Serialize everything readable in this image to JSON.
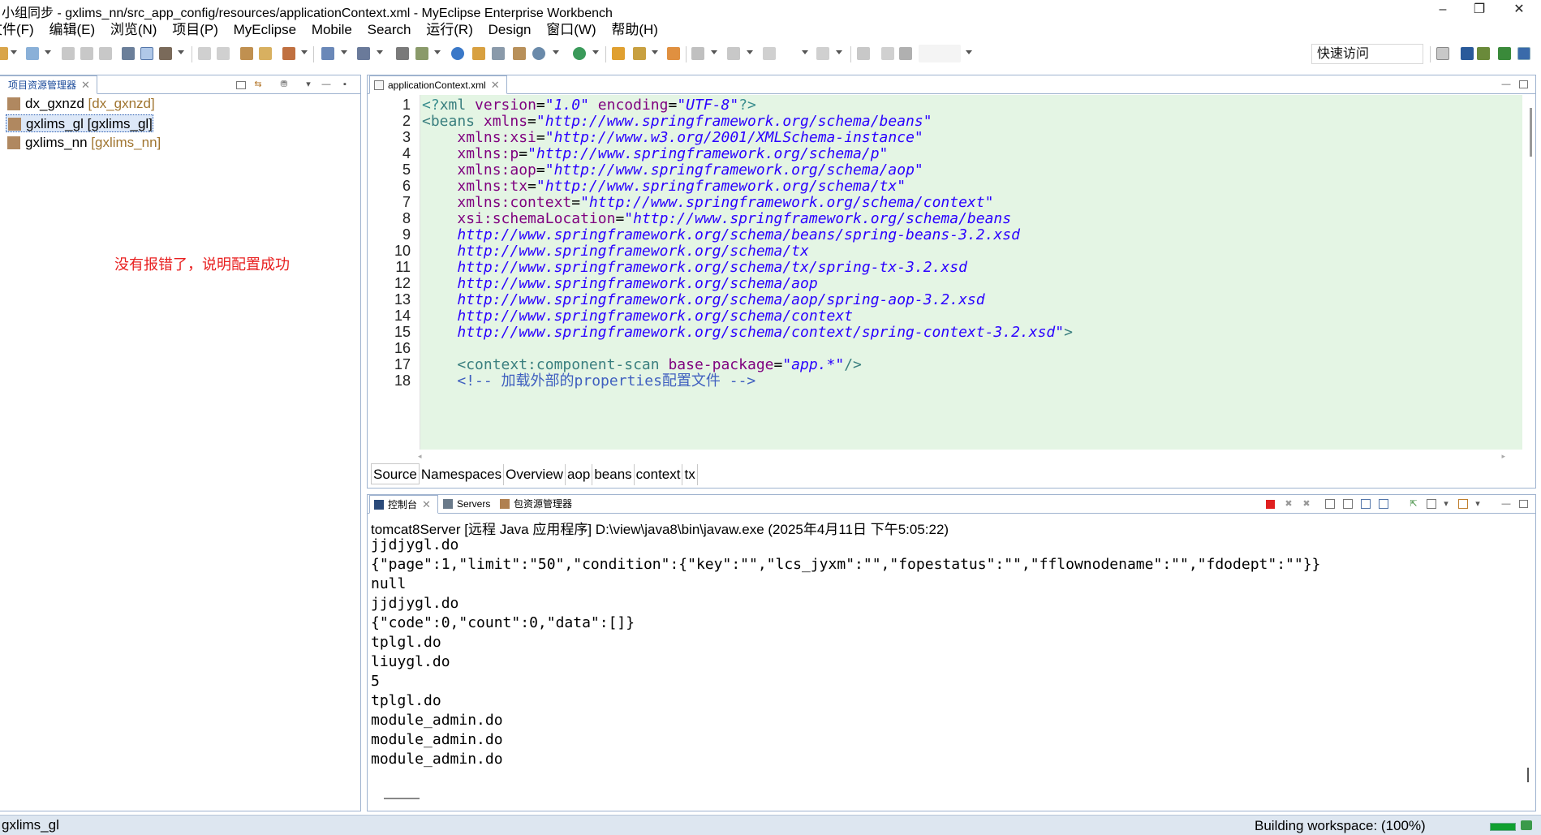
{
  "window": {
    "title": "小组同步 - gxlims_nn/src_app_config/resources/applicationContext.xml - MyEclipse Enterprise Workbench",
    "minimize": "–",
    "maximize": "❐",
    "close": "✕"
  },
  "menu": [
    "文件(F)",
    "编辑(E)",
    "浏览(N)",
    "项目(P)",
    "MyEclipse",
    "Mobile",
    "Search",
    "运行(R)",
    "Design",
    "窗口(W)",
    "帮助(H)"
  ],
  "toolbar": {
    "quick_access": "快速访问"
  },
  "explorer": {
    "tab_label": "项目资源管理器",
    "close": "✕",
    "projects": [
      {
        "name": "dx_gxnzd",
        "decoration": "[dx_gxnzd]"
      },
      {
        "name": "gxlims_gl",
        "decoration": "[gxlims_gl]"
      },
      {
        "name": "gxlims_nn",
        "decoration": "[gxlims_nn]"
      }
    ],
    "note": "没有报错了，说明配置成功"
  },
  "editor": {
    "tab_label": "applicationContext.xml",
    "close": "✕",
    "line_numbers": [
      "1",
      "2",
      "3",
      "4",
      "5",
      "6",
      "7",
      "8",
      "9",
      "10",
      "11",
      "12",
      "13",
      "14",
      "15",
      "16",
      "17",
      "18"
    ],
    "bottom_tabs": [
      "Source",
      "Namespaces",
      "Overview",
      "aop",
      "beans",
      "context",
      "tx"
    ]
  },
  "console": {
    "tabs": [
      "控制台",
      "Servers",
      "包资源管理器"
    ],
    "close": "✕",
    "header": "tomcat8Server [远程 Java 应用程序] D:\\view\\java8\\bin\\javaw.exe  (2025年4月11日 下午5:05:22)",
    "lines": [
      "jjdjygl.do",
      "{\"page\":1,\"limit\":\"50\",\"condition\":{\"key\":\"\",\"lcs_jyxm\":\"\",\"fopestatus\":\"\",\"fflownodename\":\"\",\"fdodept\":\"\"}}",
      "null",
      "jjdjygl.do",
      "{\"code\":0,\"count\":0,\"data\":[]}",
      "tplgl.do",
      "liuygl.do",
      "5",
      "tplgl.do",
      "module_admin.do",
      "module_admin.do",
      "module_admin.do"
    ]
  },
  "status": {
    "selected": "gxlims_gl",
    "building": "Building workspace:   (100%)",
    "progress": 1.0
  },
  "colors": {
    "code_highlight": "#e4f5e4",
    "note_red": "#e82020",
    "panel_border": "#9fb3cf"
  }
}
